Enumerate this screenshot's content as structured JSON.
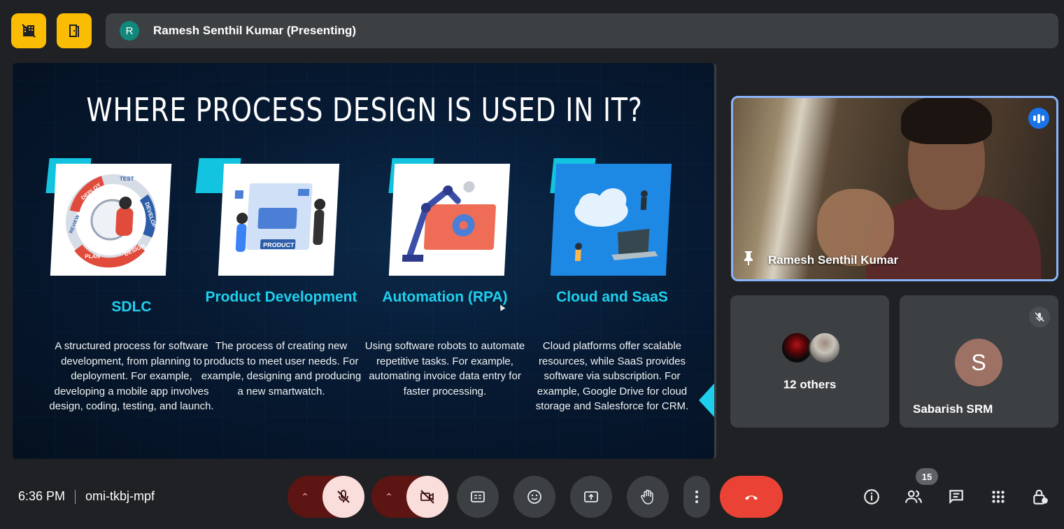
{
  "top_bar": {
    "presenter_initial": "R",
    "presenter_label": "Ramesh Senthil Kumar (Presenting)"
  },
  "slide": {
    "title": "WHERE PROCESS DESIGN IS USED IN IT?",
    "cards": [
      {
        "heading": "SDLC",
        "description": "A structured process for software development, from planning to deployment. For example, developing a mobile app involves design, coding, testing, and launch.",
        "image_labels": [
          "DEPLOY",
          "TEST",
          "DEVELOP",
          "REVIEW",
          "PLAN",
          "DESIGN"
        ]
      },
      {
        "heading": "Product Development",
        "description": "The process of creating new products to meet user needs. For example, designing and producing a new smartwatch.",
        "image_labels": [
          "PRODUCT"
        ]
      },
      {
        "heading": "Automation (RPA)",
        "description": "Using software robots to automate repetitive tasks. For example, automating invoice data entry for faster processing.",
        "image_labels": []
      },
      {
        "heading": "Cloud and SaaS",
        "description": "Cloud platforms offer scalable resources, while SaaS provides software via subscription. For example, Google Drive for cloud storage and Salesforce for CRM.",
        "image_labels": []
      }
    ]
  },
  "participants": {
    "pinned": {
      "name": "Ramesh Senthil Kumar",
      "speaking": true
    },
    "others": {
      "label": "12 others"
    },
    "sabarish": {
      "initial": "S",
      "name": "Sabarish SRM",
      "muted": true
    }
  },
  "bottom_bar": {
    "time": "6:36 PM",
    "meeting_code": "omi-tkbj-mpf",
    "participant_count": "15"
  },
  "icons": {
    "top_left_1": "no-building-icon",
    "top_left_2": "door-icon"
  },
  "colors": {
    "accent_yellow": "#fbbc04",
    "active_blue": "#8ab4f8",
    "hangup_red": "#ea4335",
    "slide_cyan": "#1fd0ee"
  }
}
